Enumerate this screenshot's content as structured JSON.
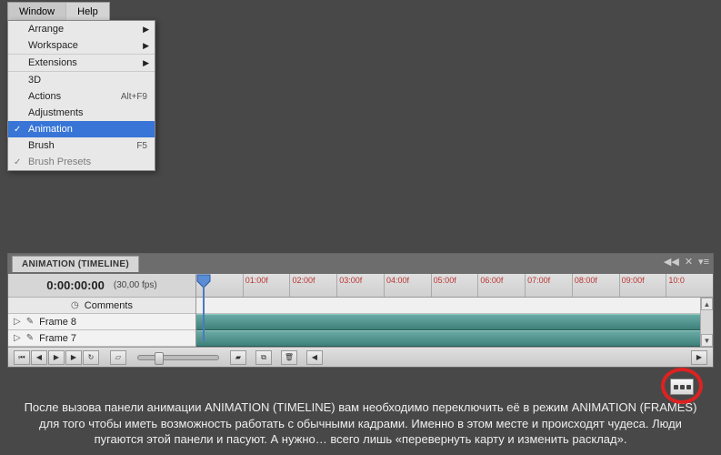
{
  "menubar": {
    "window": "Window",
    "help": "Help"
  },
  "menu": {
    "arrange": "Arrange",
    "workspace": "Workspace",
    "extensions": "Extensions",
    "threeD": "3D",
    "actions": "Actions",
    "actions_shortcut": "Alt+F9",
    "adjustments": "Adjustments",
    "animation": "Animation",
    "brush": "Brush",
    "brush_shortcut": "F5",
    "brush_presets": "Brush Presets"
  },
  "panel": {
    "tab_label": "ANIMATION (TIMELINE)",
    "timecode": "0:00:00:00",
    "fps": "(30,00 fps)",
    "comments_label": "Comments",
    "tracks": [
      "Frame 8",
      "Frame 7"
    ],
    "ruler_ticks": [
      "01:00f",
      "02:00f",
      "03:00f",
      "04:00f",
      "05:00f",
      "06:00f",
      "07:00f",
      "08:00f",
      "09:00f",
      "10:0"
    ]
  },
  "caption": "После вызова панели анимации ANIMATION (TIMELINE) вам необходимо переключить её в режим ANIMATION (FRAMES) для того чтобы иметь возможность работать с обычными кадрами. Именно в этом месте и происходят чудеса. Люди пугаются этой панели и пасуют. А нужно… всего лишь «перевернуть карту и изменить расклад»."
}
